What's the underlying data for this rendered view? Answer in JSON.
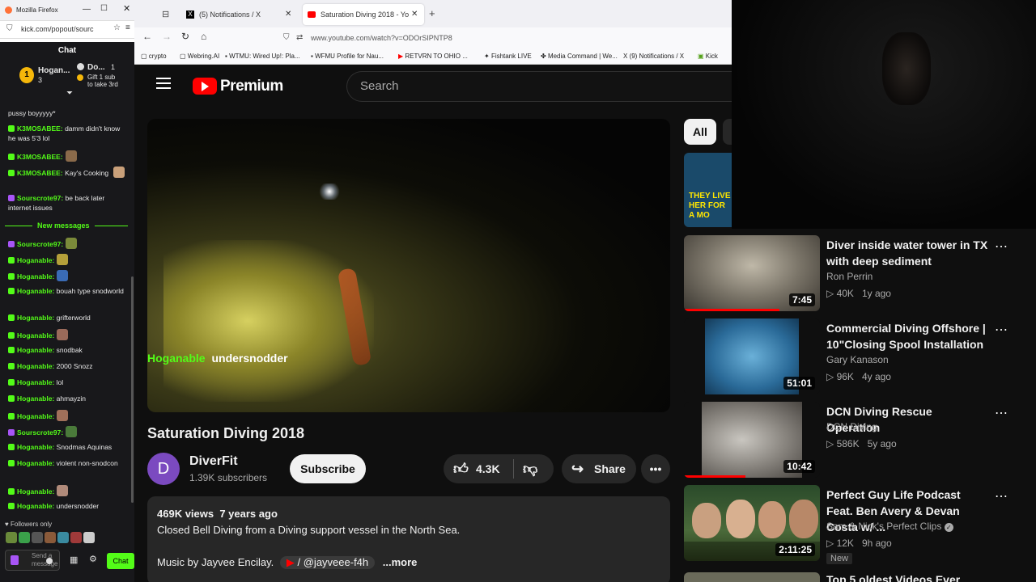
{
  "left": {
    "tab_title": "Mozilla Firefox",
    "url": "kick.com/popout/sourc",
    "chat_title": "Chat",
    "pinned": {
      "user": "Hogan...",
      "count": "3",
      "gifter": "Do...",
      "gifter_count": "1",
      "gift_text_1": "Gift 1 sub",
      "gift_text_2": "to take 3rd"
    },
    "messages": [
      {
        "user": "",
        "text": "pussy boyyyyy*"
      },
      {
        "user": "K3MOSABEE:",
        "text": "damm didn't know he was 5'3 lol"
      },
      {
        "user": "K3MOSABEE:",
        "text": ""
      },
      {
        "user": "K3MOSABEE:",
        "text": "Kay's Cooking"
      },
      {
        "user": "Sourscrote97:",
        "text": "be back later internet issues"
      }
    ],
    "new_messages": "New messages",
    "messages2": [
      {
        "user": "Sourscrote97:",
        "text": ""
      },
      {
        "user": "Hoganable:",
        "text": ""
      },
      {
        "user": "Hoganable:",
        "text": ""
      },
      {
        "user": "Hoganable:",
        "text": "bouah type snodworld"
      },
      {
        "user": "Hoganable:",
        "text": "grifterworld"
      },
      {
        "user": "Hoganable:",
        "text": ""
      },
      {
        "user": "Hoganable:",
        "text": "snodbak"
      },
      {
        "user": "Hoganable:",
        "text": "2000 Snozz"
      },
      {
        "user": "Hoganable:",
        "text": "lol"
      },
      {
        "user": "Hoganable:",
        "text": "ahmayzin"
      },
      {
        "user": "Hoganable:",
        "text": ""
      },
      {
        "user": "Sourscrote97:",
        "text": ""
      },
      {
        "user": "Hoganable:",
        "text": "Snodmas Aquinas"
      },
      {
        "user": "Hoganable:",
        "text": "violent non-snodcon"
      },
      {
        "user": "Hoganable:",
        "text": ""
      },
      {
        "user": "Hoganable:",
        "text": "undersnodder"
      }
    ],
    "followers_only": "Followers only",
    "send_placeholder": "Send a message",
    "chat_button": "Chat"
  },
  "browser": {
    "tabs": [
      {
        "label": "(5) Notifications / X"
      },
      {
        "label": "Saturation Diving 2018 - Yo"
      }
    ],
    "url": "www.youtube.com/watch?v=ODOrSIPNTP8",
    "bookmarks": [
      "crypto",
      "Webring.AI",
      "WTMU: Wired Up!: Pla...",
      "WFMU Profile for Nau...",
      "RETVRN TO OHIO ...",
      "Fishtank LIVE",
      "Media Command | We...",
      "(9) Notifications / X",
      "Kick"
    ]
  },
  "youtube": {
    "logo_text": "Premium",
    "search_placeholder": "Search",
    "overlay_user": "Hoganable",
    "overlay_text": "undersnodder",
    "video_title": "Saturation Diving 2018",
    "channel_initial": "D",
    "channel_name": "DiverFit",
    "subscribers": "1.39K subscribers",
    "subscribe_label": "Subscribe",
    "likes": "4.3K",
    "share_label": "Share",
    "views": "469K views",
    "age": "7 years ago",
    "description": "Closed Bell Diving from a Diving support vessel in the North Sea.",
    "music_line": "Music by Jayvee Encilay.",
    "music_link": "/ @jayveee-f4h",
    "more_label": "...more",
    "filter_all": "All",
    "recommendations": [
      {
        "title": "Diver inside water tower in TX with deep sediment",
        "channel": "Ron Perrin",
        "views": "40K",
        "age": "1y ago",
        "duration": "7:45",
        "verified": false,
        "badge": "",
        "progress": 0.7
      },
      {
        "title": "Commercial Diving Offshore | 10\"Closing Spool Installation",
        "channel": "Gary Kanason",
        "views": "96K",
        "age": "4y ago",
        "duration": "51:01",
        "verified": false,
        "badge": "",
        "progress": 0
      },
      {
        "title": "DCN Diving Rescue Operation",
        "channel": "DCN Diving",
        "views": "586K",
        "age": "5y ago",
        "duration": "10:42",
        "verified": false,
        "badge": "",
        "progress": 0.45
      },
      {
        "title": "Perfect Guy Life Podcast Feat. Ben Avery & Devan Costa w/ ...",
        "channel": "Sam & Nick's Perfect Clips",
        "views": "12K",
        "age": "9h ago",
        "duration": "2:11:25",
        "verified": true,
        "badge": "New",
        "progress": 0
      }
    ],
    "partial_next_title": "Top 5 oldest Videos Ever",
    "top_thumb_text": "THEY LIVE HER FOR A MO"
  },
  "colors": {
    "kick_green": "#53fc18",
    "yt_red": "#ff0000",
    "accent_purple": "#a855f7"
  }
}
